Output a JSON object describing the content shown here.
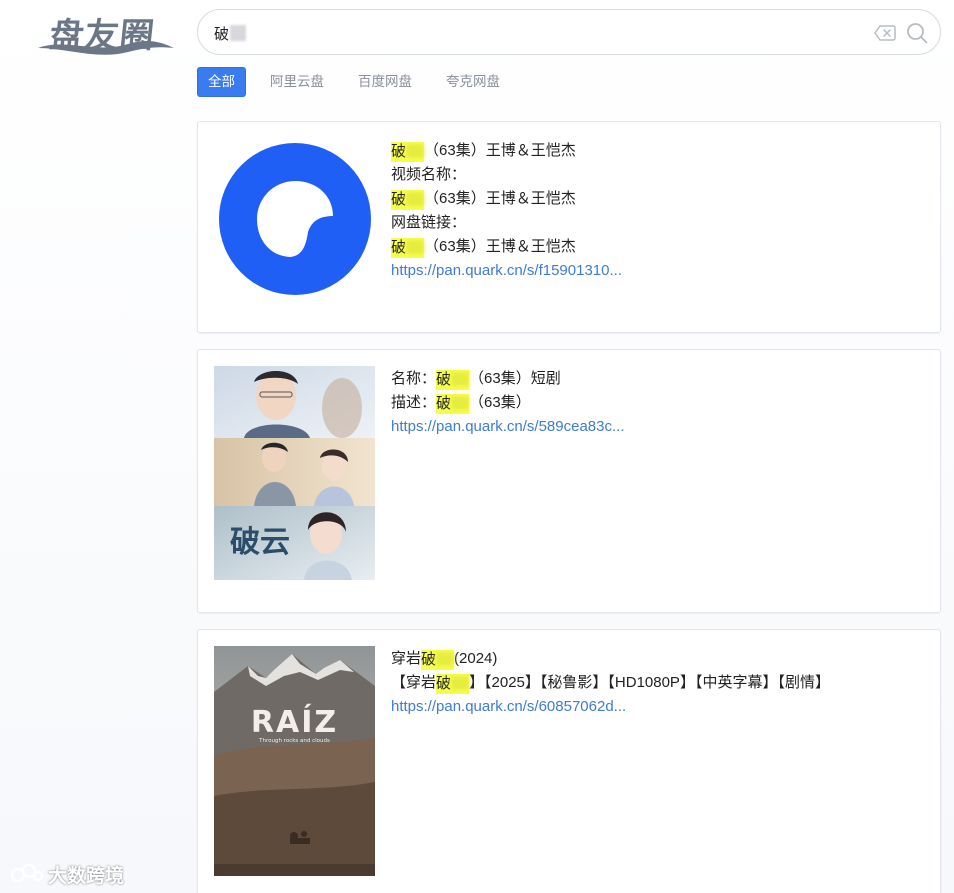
{
  "logo": {
    "text": "盘友圈"
  },
  "search": {
    "value": "破"
  },
  "tabs": [
    {
      "label": "全部",
      "active": true
    },
    {
      "label": "阿里云盘",
      "active": false
    },
    {
      "label": "百度网盘",
      "active": false
    },
    {
      "label": "夸克网盘",
      "active": false
    }
  ],
  "results": [
    {
      "thumb": "quark-logo",
      "lines": {
        "l1_hl": "破",
        "l1_rest": "（63集）王博＆王恺杰",
        "l2": "视频名称：",
        "l3_hl": "破",
        "l3_rest": "（63集）王博＆王恺杰",
        "l4": "网盘链接：",
        "l5_hl": "破",
        "l5_rest": "（63集）王博＆王恺杰",
        "link": "https://pan.quark.cn/s/f15901310..."
      }
    },
    {
      "thumb": "drama-poster",
      "poster_title": "破云",
      "lines": {
        "l1_prefix": "名称：",
        "l1_hl": "破",
        "l1_rest": "（63集）短剧",
        "l2_prefix": "描述：",
        "l2_hl": "破",
        "l2_rest": "（63集）",
        "link": "https://pan.quark.cn/s/589cea83c..."
      }
    },
    {
      "thumb": "movie-poster",
      "poster_title": "RAÍZ",
      "poster_subtitle": "Through rocks and clouds",
      "lines": {
        "l1_prefix": "穿岩",
        "l1_hl": "破",
        "l1_rest": "(2024)",
        "l2_prefix": "【穿岩",
        "l2_hl": "破",
        "l2_rest": "】【2025】【秘鲁影】【HD1080P】【中英字幕】【剧情】",
        "link": "https://pan.quark.cn/s/60857062d..."
      }
    }
  ],
  "watermark": {
    "text": "大数跨境"
  },
  "colors": {
    "accent": "#3a7bf0",
    "link": "#3d7bd6",
    "highlight": "#f6ff4a",
    "quark_blue": "#1f5ff5"
  }
}
